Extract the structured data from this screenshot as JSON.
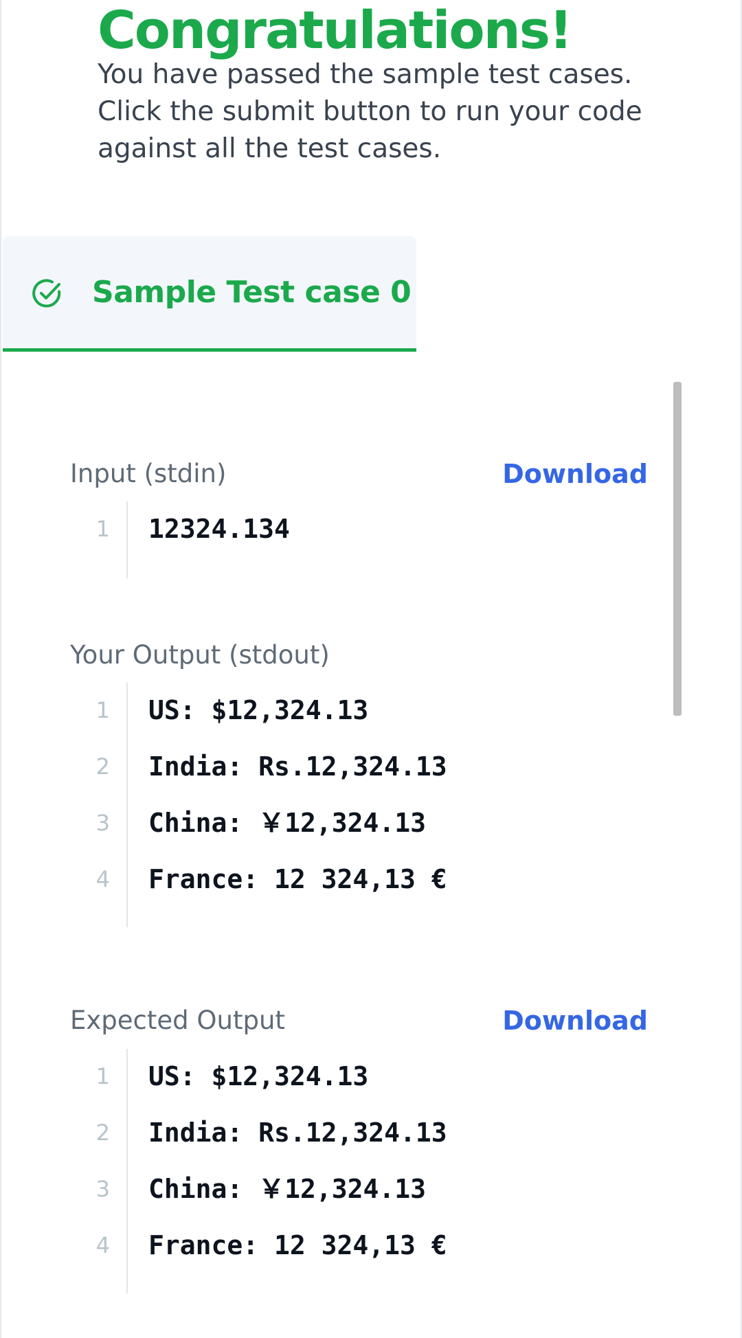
{
  "header": {
    "title": "Congratulations!",
    "message": "You have passed the sample test cases. Click the submit button to run your code against all the test cases."
  },
  "tab": {
    "label": "Sample Test case 0",
    "icon": "check-circle-icon",
    "accent_color": "#1ba94c"
  },
  "input": {
    "label": "Input (stdin)",
    "download_label": "Download",
    "lines": [
      {
        "num": "1",
        "text": "12324.134"
      }
    ]
  },
  "your_output": {
    "label": "Your Output (stdout)",
    "lines": [
      {
        "num": "1",
        "text": "US: $12,324.13"
      },
      {
        "num": "2",
        "text": "India: Rs.12,324.13"
      },
      {
        "num": "3",
        "text": "China: ￥12,324.13"
      },
      {
        "num": "4",
        "text": "France: 12 324,13 €"
      }
    ]
  },
  "expected_output": {
    "label": "Expected Output",
    "download_label": "Download",
    "lines": [
      {
        "num": "1",
        "text": "US: $12,324.13"
      },
      {
        "num": "2",
        "text": "India: Rs.12,324.13"
      },
      {
        "num": "3",
        "text": "China: ￥12,324.13"
      },
      {
        "num": "4",
        "text": "France: 12 324,13 €"
      }
    ]
  },
  "colors": {
    "success": "#1ba94c",
    "link": "#3567e4",
    "muted": "#5e6a76"
  }
}
